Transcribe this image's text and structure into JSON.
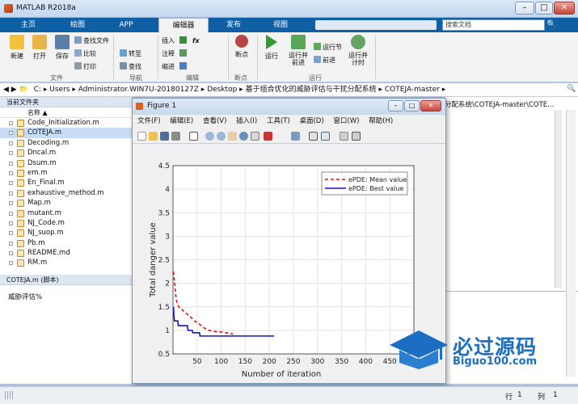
{
  "app": {
    "title": "MATLAB R2018a"
  },
  "window_controls": {
    "minimize": "–",
    "maximize": "□",
    "close": "✕"
  },
  "tabs": [
    {
      "label": "主页"
    },
    {
      "label": "绘图"
    },
    {
      "label": "APP"
    },
    {
      "label": "编辑器"
    },
    {
      "label": "发布"
    },
    {
      "label": "视图"
    }
  ],
  "search": {
    "placeholder": "搜索文档"
  },
  "ribbon": {
    "file_group": {
      "new": "新建",
      "open": "打开",
      "save": "保存",
      "find_files": "查找文件",
      "compare": "比较",
      "print": "打印",
      "label": "文件"
    },
    "nav_group": {
      "goto": "转至",
      "find": "查找",
      "label": "导航"
    },
    "edit_group": {
      "insert": "插入",
      "comment": "注释",
      "indent": "缩进",
      "fx": "fx",
      "label": "编辑"
    },
    "breakpoint_group": {
      "breakpoints": "断点",
      "label": "断点"
    },
    "run_group": {
      "run": "运行",
      "run_advance": "运行并\n前进",
      "run_section": "运行节",
      "advance": "前进",
      "run_time": "运行并\n计时",
      "label": "运行"
    }
  },
  "address": {
    "path": [
      "C:",
      "Users",
      "Administrator.WIN7U-20180127Z",
      "Desktop",
      "基于组合优化的威胁评估与干扰分配系统",
      "COTEJA-master"
    ]
  },
  "current_folder": {
    "title": "当前文件夹",
    "column": "名称 ▲",
    "files": [
      {
        "name": "Code_Initialization.m",
        "selected": false
      },
      {
        "name": "COTEJA.m",
        "selected": true
      },
      {
        "name": "Decoding.m",
        "selected": false
      },
      {
        "name": "Dncal.m",
        "selected": false
      },
      {
        "name": "Dsum.m",
        "selected": false
      },
      {
        "name": "em.m",
        "selected": false
      },
      {
        "name": "En_Final.m",
        "selected": false
      },
      {
        "name": "exhaustive_method.m",
        "selected": false
      },
      {
        "name": "Map.m",
        "selected": false
      },
      {
        "name": "mutant.m",
        "selected": false
      },
      {
        "name": "NJ_Code.m",
        "selected": false
      },
      {
        "name": "NJ_suop.m",
        "selected": false
      },
      {
        "name": "Pb.m",
        "selected": false
      },
      {
        "name": "README.md",
        "selected": false
      },
      {
        "name": "RM.m",
        "selected": false
      }
    ],
    "details_title": "COTEJA.m  (脚本)",
    "details_text": "威胁评估%"
  },
  "right_panel": {
    "path_fragment": "分配系统\\COTEJA-master\\COTE..."
  },
  "figure": {
    "title": "Figure 1",
    "menu": [
      "文件(F)",
      "编辑(E)",
      "查看(V)",
      "插入(I)",
      "工具(T)",
      "桌面(D)",
      "窗口(W)",
      "帮助(H)"
    ]
  },
  "chart_data": {
    "type": "line",
    "title": "",
    "xlabel": "Number of iteration",
    "ylabel": "Total danger value",
    "xlim": [
      0,
      500
    ],
    "ylim": [
      0.5,
      4.5
    ],
    "xticks": [
      50,
      100,
      150,
      200,
      250,
      300,
      350,
      400,
      450,
      500
    ],
    "yticks": [
      0.5,
      1,
      1.5,
      2,
      2.5,
      3,
      3.5,
      4,
      4.5
    ],
    "grid": true,
    "legend_position": "top-right",
    "series": [
      {
        "name": "ePDE: Mean value",
        "color": "#e01010",
        "style": "dashed",
        "x": [
          1,
          3,
          5,
          8,
          12,
          18,
          25,
          35,
          45,
          55,
          65,
          75,
          85,
          95,
          105,
          115,
          125
        ],
        "y": [
          2.25,
          2.05,
          1.8,
          1.6,
          1.5,
          1.45,
          1.38,
          1.3,
          1.2,
          1.13,
          1.05,
          1.0,
          0.98,
          0.97,
          0.96,
          0.94,
          0.92
        ]
      },
      {
        "name": "ePDE: Best value",
        "color": "#1010d0",
        "style": "solid",
        "x": [
          1,
          2,
          3,
          10,
          11,
          30,
          31,
          40,
          41,
          55,
          56,
          210
        ],
        "y": [
          1.5,
          1.3,
          1.2,
          1.2,
          1.1,
          1.1,
          1.0,
          1.0,
          0.95,
          0.95,
          0.88,
          0.88
        ]
      }
    ]
  },
  "status": {
    "row_label": "行",
    "row": "1",
    "col_label": "列",
    "col": "1"
  },
  "watermark": {
    "text": "必过源码",
    "sub": "Biguo100.com"
  }
}
